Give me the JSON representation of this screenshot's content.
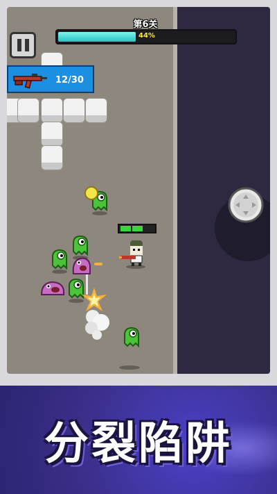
{
  "hud": {
    "level_label": "第6关",
    "progress_label": "44%",
    "progress_value": 0.44,
    "ammo_label": "12/30"
  },
  "player": {
    "health_segments_filled": 2,
    "health_segments_total": 3
  },
  "banner": {
    "title": "分裂陷阱"
  },
  "colors": {
    "progress_fill": "#27c3c0",
    "weapon_panel": "#1d8fe0",
    "health": "#3dd33b",
    "banner_bg": "#3a2f8a",
    "enemy_green": "#4cc43a",
    "enemy_pink": "#c86bc4"
  },
  "icons": {
    "pause": "pause-icon",
    "weapon": "rifle-icon",
    "joystick": "joystick-knob-icon"
  }
}
